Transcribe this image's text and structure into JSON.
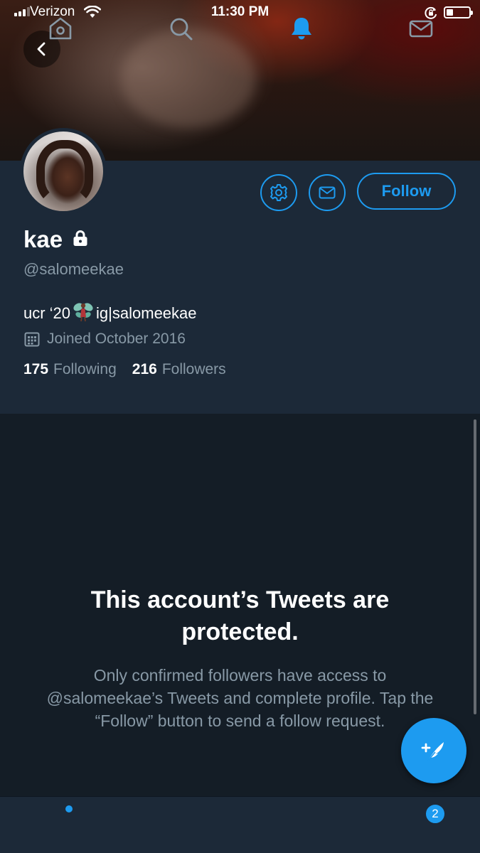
{
  "status_bar": {
    "carrier": "Verizon",
    "time": "11:30 PM",
    "signal_bars": 3,
    "signal_bars_total": 4,
    "battery_level": 0.3
  },
  "profile": {
    "display_name": "kae",
    "handle": "@salomeekae",
    "bio_before": "ucr ‘20",
    "bio_after": "ig|salomeekae",
    "joined": "Joined October 2016",
    "following_count": "175",
    "following_label": "Following",
    "followers_count": "216",
    "followers_label": "Followers",
    "follow_label": "Follow"
  },
  "protected_notice": {
    "title": "This account’s Tweets are protected.",
    "body": "Only confirmed followers have access to @salomeekae’s Tweets and complete profile. Tap the “Follow” button to send a follow request."
  },
  "tab_bar": {
    "tabs": [
      "home-icon",
      "search-icon",
      "notifications-icon",
      "messages-icon"
    ],
    "active_tab": "notifications-icon",
    "messages_badge": "2"
  },
  "colors": {
    "accent": "#1d9bf0",
    "panel": "#1c2938",
    "background": "#141d26",
    "secondary_text": "#8899a6"
  }
}
